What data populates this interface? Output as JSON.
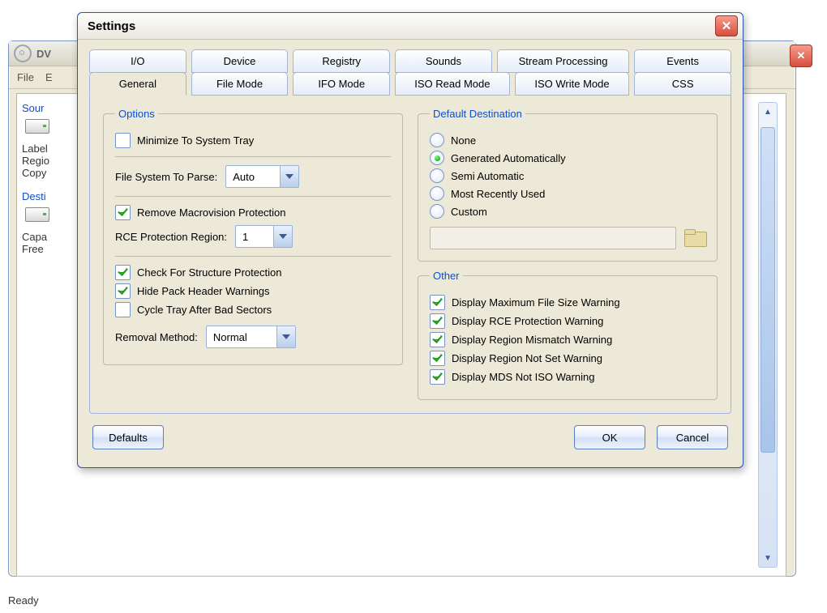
{
  "bg": {
    "title_prefix": "DV",
    "menu": {
      "file": "File",
      "e": "E"
    },
    "source": {
      "heading": "Sour",
      "label": "Label",
      "region": "Regio",
      "copy": "Copy"
    },
    "dest": {
      "heading": "Desti",
      "capa": "Capa",
      "free": "Free"
    },
    "status": "Ready"
  },
  "dialog": {
    "title": "Settings",
    "tabs_row1": [
      "I/O",
      "Device",
      "Registry",
      "Sounds",
      "Stream Processing",
      "Events"
    ],
    "tabs_row2": [
      "General",
      "File Mode",
      "IFO Mode",
      "ISO Read Mode",
      "ISO Write Mode",
      "CSS"
    ],
    "active_tab": "General",
    "options": {
      "legend": "Options",
      "minimize": {
        "label": "Minimize To System Tray",
        "checked": false
      },
      "fs_label": "File System To Parse:",
      "fs_value": "Auto",
      "macrovision": {
        "label": "Remove Macrovision Protection",
        "checked": true
      },
      "rce_label": "RCE Protection Region:",
      "rce_value": "1",
      "structure_prot": {
        "label": "Check For Structure Protection",
        "checked": true
      },
      "hide_pack": {
        "label": "Hide Pack Header Warnings",
        "checked": true
      },
      "cycle_tray": {
        "label": "Cycle Tray After Bad Sectors",
        "checked": false
      },
      "removal_label": "Removal Method:",
      "removal_value": "Normal"
    },
    "dest": {
      "legend": "Default Destination",
      "radios": [
        {
          "label": "None",
          "selected": false
        },
        {
          "label": "Generated Automatically",
          "selected": true
        },
        {
          "label": "Semi Automatic",
          "selected": false
        },
        {
          "label": "Most Recently Used",
          "selected": false
        },
        {
          "label": "Custom",
          "selected": false
        }
      ],
      "path_value": ""
    },
    "other": {
      "legend": "Other",
      "checks": [
        {
          "label": "Display Maximum File Size Warning",
          "checked": true
        },
        {
          "label": "Display RCE Protection Warning",
          "checked": true
        },
        {
          "label": "Display Region Mismatch Warning",
          "checked": true
        },
        {
          "label": "Display Region Not Set Warning",
          "checked": true
        },
        {
          "label": "Display MDS Not ISO Warning",
          "checked": true
        }
      ]
    },
    "buttons": {
      "defaults": "Defaults",
      "ok": "OK",
      "cancel": "Cancel"
    }
  }
}
